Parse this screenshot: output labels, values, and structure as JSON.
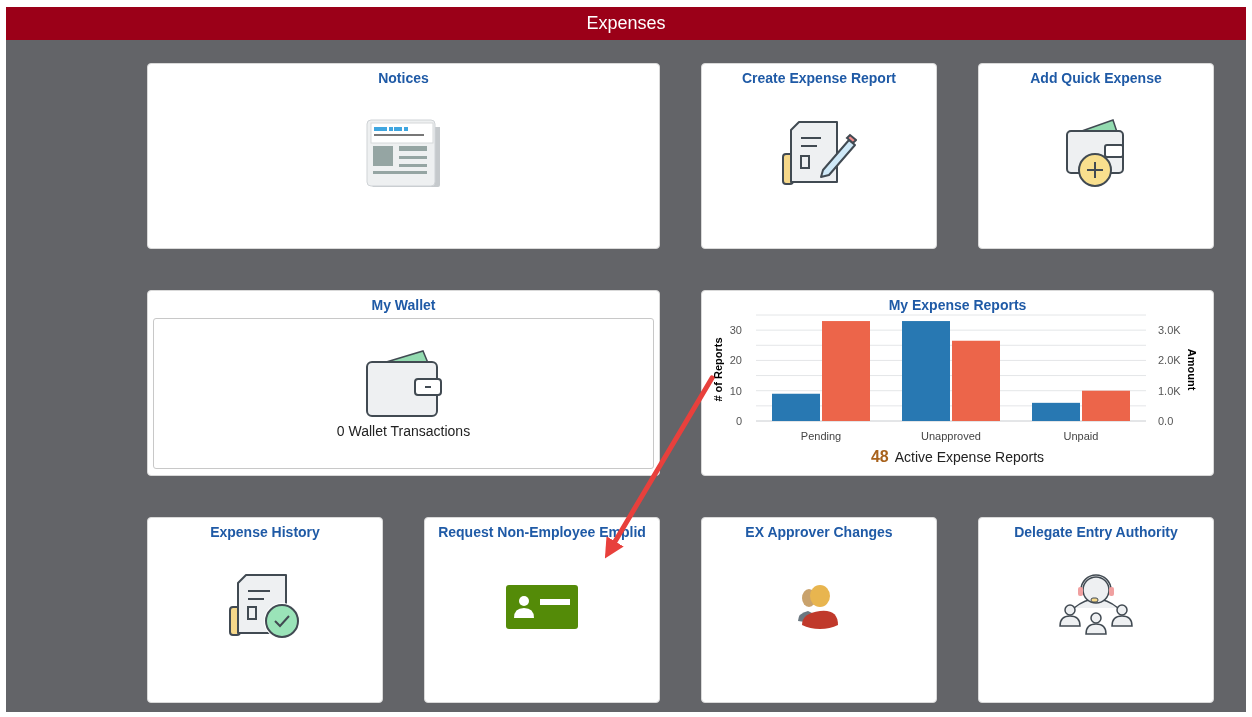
{
  "header": {
    "title": "Expenses"
  },
  "tiles": [
    {
      "kind": "icon",
      "wide": true,
      "title": "Notices"
    },
    {
      "kind": "icon",
      "wide": false,
      "title": "Create Expense Report"
    },
    {
      "kind": "icon",
      "wide": false,
      "title": "Add Quick Expense"
    },
    {
      "kind": "wallet",
      "wide": true,
      "title": "My Wallet",
      "caption": "0 Wallet Transactions"
    },
    {
      "kind": "chart",
      "wide": true,
      "title": "My Expense Reports",
      "count": "48",
      "count_label": "Active Expense Reports",
      "chart_data": {
        "type": "bar",
        "ylabel": "# of Reports",
        "y2label": "Amount",
        "grid": true,
        "categories": [
          "Pending",
          "Unapproved",
          "Unpaid"
        ],
        "ylim": [
          0,
          35
        ],
        "y2lim": [
          0,
          3500
        ],
        "yticks": [
          0,
          10,
          20,
          30
        ],
        "y2ticks": [
          {
            "value": 0,
            "label": "0.0"
          },
          {
            "value": 1000,
            "label": "1.0K"
          },
          {
            "value": 2000,
            "label": "2.0K"
          },
          {
            "value": 3000,
            "label": "3.0K"
          }
        ],
        "series": [
          {
            "color": "#2878b2",
            "values": [
              9,
              33,
              6
            ]
          },
          {
            "color": "#ec654a",
            "axis": "y2",
            "values": [
              3300,
              2650,
              1000
            ]
          }
        ]
      }
    },
    {
      "kind": "icon",
      "wide": false,
      "title": "Expense History"
    },
    {
      "kind": "icon",
      "wide": false,
      "title": "Request Non-Employee Emplid"
    },
    {
      "kind": "icon",
      "wide": false,
      "title": "EX Approver Changes"
    },
    {
      "kind": "icon",
      "wide": false,
      "title": "Delegate Entry Authority"
    }
  ]
}
